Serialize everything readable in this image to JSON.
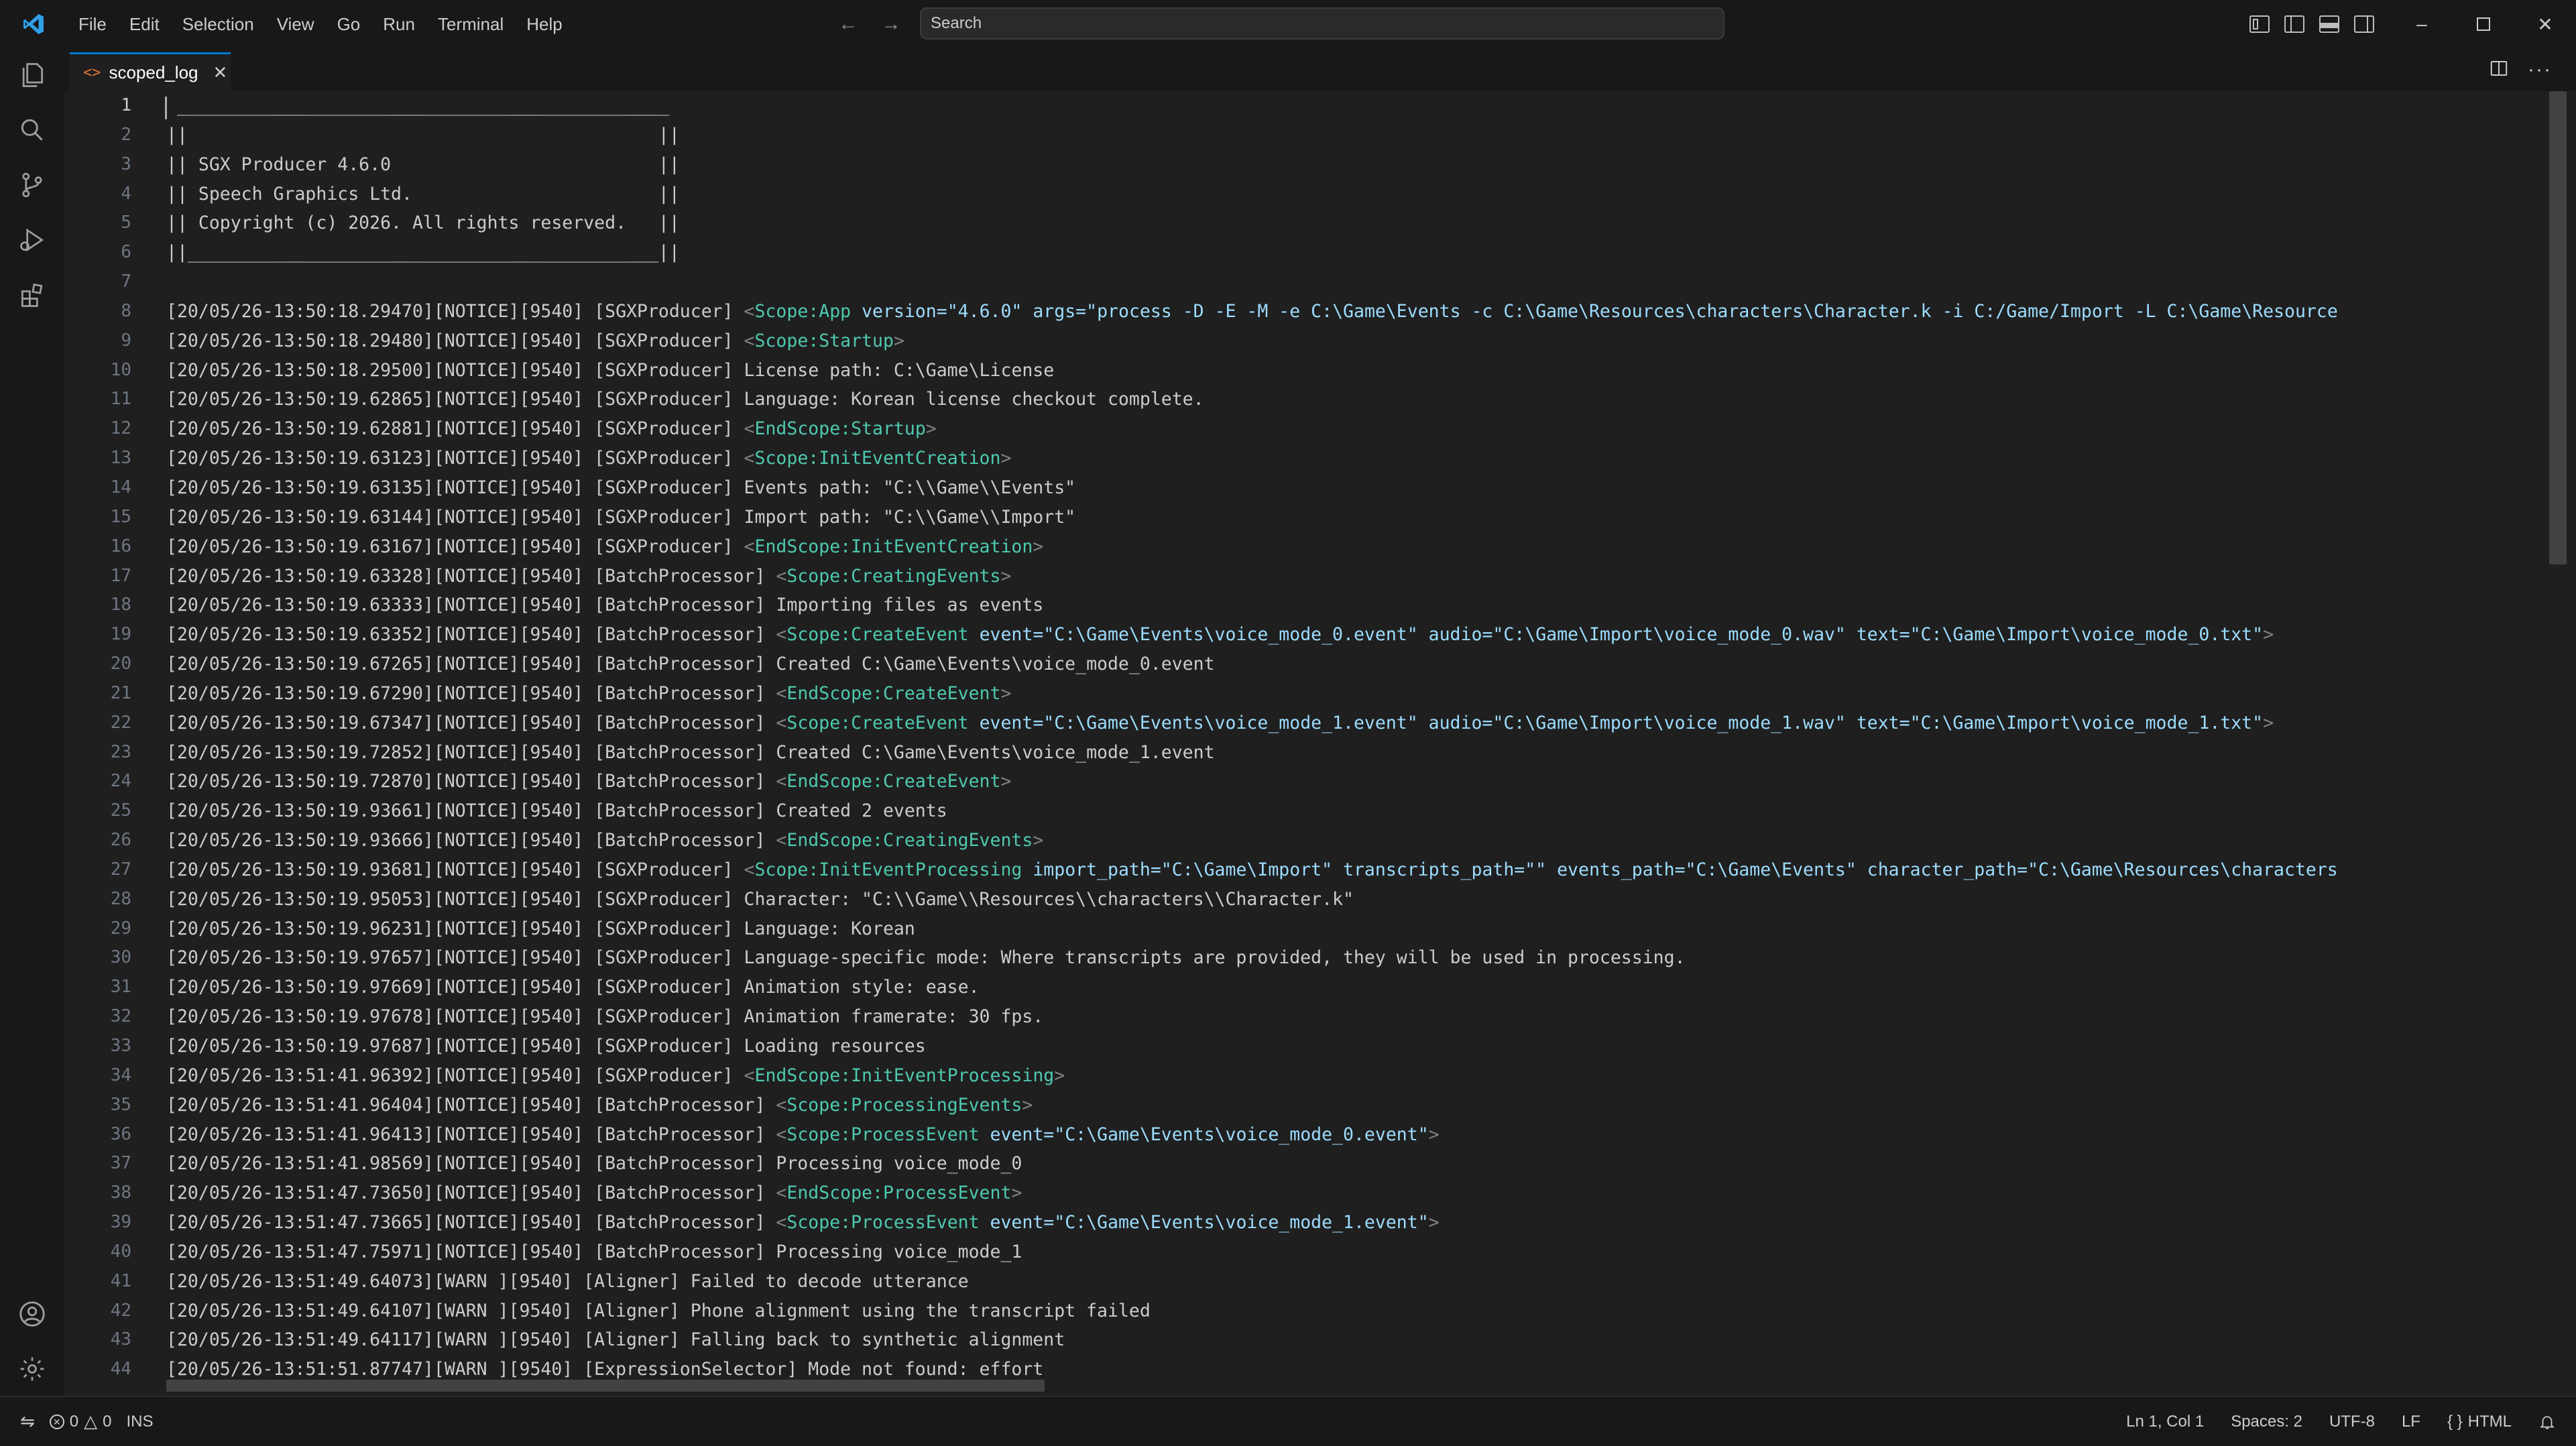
{
  "titlebar": {
    "menus": [
      "File",
      "Edit",
      "Selection",
      "View",
      "Go",
      "Run",
      "Terminal",
      "Help"
    ],
    "search_placeholder": "Search"
  },
  "tab": {
    "label": "scoped_log"
  },
  "editor": {
    "lines": [
      {
        "n": "1",
        "segs": [
          {
            "t": " ______________________________________________"
          }
        ]
      },
      {
        "n": "2",
        "segs": [
          {
            "t": "||                                            ||"
          }
        ]
      },
      {
        "n": "3",
        "segs": [
          {
            "t": "|| SGX Producer 4.6.0                         ||"
          }
        ]
      },
      {
        "n": "4",
        "segs": [
          {
            "t": "|| Speech Graphics Ltd.                       ||"
          }
        ]
      },
      {
        "n": "5",
        "segs": [
          {
            "t": "|| Copyright (c) 2026. All rights reserved.   ||"
          }
        ]
      },
      {
        "n": "6",
        "segs": [
          {
            "t": "||____________________________________________||"
          }
        ]
      },
      {
        "n": "7",
        "segs": [
          {
            "t": ""
          }
        ]
      },
      {
        "n": "8",
        "segs": [
          {
            "t": "[20/05/26-13:50:18.29470][NOTICE][9540] [SGXProducer] "
          },
          {
            "t": "<",
            "c": "tg"
          },
          {
            "t": "Scope:App",
            "c": "nm"
          },
          {
            "t": " version=",
            "c": "at"
          },
          {
            "t": "\"4.6.0\"",
            "c": "at"
          },
          {
            "t": " args=",
            "c": "at"
          },
          {
            "t": "\"process -D -E -M -e C:\\Game\\Events -c C:\\Game\\Resources\\characters\\Character.k -i C:/Game/Import -L C:\\Game\\Resource",
            "c": "at"
          }
        ]
      },
      {
        "n": "9",
        "segs": [
          {
            "t": "[20/05/26-13:50:18.29480][NOTICE][9540] [SGXProducer] "
          },
          {
            "t": "<",
            "c": "tg"
          },
          {
            "t": "Scope:Startup",
            "c": "nm"
          },
          {
            "t": ">",
            "c": "tg"
          }
        ]
      },
      {
        "n": "10",
        "segs": [
          {
            "t": "[20/05/26-13:50:18.29500][NOTICE][9540] [SGXProducer] License path: C:\\Game\\License"
          }
        ]
      },
      {
        "n": "11",
        "segs": [
          {
            "t": "[20/05/26-13:50:19.62865][NOTICE][9540] [SGXProducer] Language: Korean license checkout complete."
          }
        ]
      },
      {
        "n": "12",
        "segs": [
          {
            "t": "[20/05/26-13:50:19.62881][NOTICE][9540] [SGXProducer] "
          },
          {
            "t": "<",
            "c": "tg"
          },
          {
            "t": "EndScope:Startup",
            "c": "en"
          },
          {
            "t": ">",
            "c": "tg"
          }
        ]
      },
      {
        "n": "13",
        "segs": [
          {
            "t": "[20/05/26-13:50:19.63123][NOTICE][9540] [SGXProducer] "
          },
          {
            "t": "<",
            "c": "tg"
          },
          {
            "t": "Scope:InitEventCreation",
            "c": "nm"
          },
          {
            "t": ">",
            "c": "tg"
          }
        ]
      },
      {
        "n": "14",
        "segs": [
          {
            "t": "[20/05/26-13:50:19.63135][NOTICE][9540] [SGXProducer] Events path: \"C:\\\\Game\\\\Events\""
          }
        ]
      },
      {
        "n": "15",
        "segs": [
          {
            "t": "[20/05/26-13:50:19.63144][NOTICE][9540] [SGXProducer] Import path: \"C:\\\\Game\\\\Import\""
          }
        ]
      },
      {
        "n": "16",
        "segs": [
          {
            "t": "[20/05/26-13:50:19.63167][NOTICE][9540] [SGXProducer] "
          },
          {
            "t": "<",
            "c": "tg"
          },
          {
            "t": "EndScope:InitEventCreation",
            "c": "en"
          },
          {
            "t": ">",
            "c": "tg"
          }
        ]
      },
      {
        "n": "17",
        "segs": [
          {
            "t": "[20/05/26-13:50:19.63328][NOTICE][9540] [BatchProcessor] "
          },
          {
            "t": "<",
            "c": "tg"
          },
          {
            "t": "Scope:CreatingEvents",
            "c": "nm"
          },
          {
            "t": ">",
            "c": "tg"
          }
        ]
      },
      {
        "n": "18",
        "segs": [
          {
            "t": "[20/05/26-13:50:19.63333][NOTICE][9540] [BatchProcessor] Importing files as events"
          }
        ]
      },
      {
        "n": "19",
        "segs": [
          {
            "t": "[20/05/26-13:50:19.63352][NOTICE][9540] [BatchProcessor] "
          },
          {
            "t": "<",
            "c": "tg"
          },
          {
            "t": "Scope:CreateEvent",
            "c": "nm"
          },
          {
            "t": " event=\"C:\\Game\\Events\\voice_mode_0.event\" audio=\"C:\\Game\\Import\\voice_mode_0.wav\" text=\"C:\\Game\\Import\\voice_mode_0.txt\"",
            "c": "at"
          },
          {
            "t": ">",
            "c": "tg"
          }
        ]
      },
      {
        "n": "20",
        "segs": [
          {
            "t": "[20/05/26-13:50:19.67265][NOTICE][9540] [BatchProcessor] Created C:\\Game\\Events\\voice_mode_0.event"
          }
        ]
      },
      {
        "n": "21",
        "segs": [
          {
            "t": "[20/05/26-13:50:19.67290][NOTICE][9540] [BatchProcessor] "
          },
          {
            "t": "<",
            "c": "tg"
          },
          {
            "t": "EndScope:CreateEvent",
            "c": "en"
          },
          {
            "t": ">",
            "c": "tg"
          }
        ]
      },
      {
        "n": "22",
        "segs": [
          {
            "t": "[20/05/26-13:50:19.67347][NOTICE][9540] [BatchProcessor] "
          },
          {
            "t": "<",
            "c": "tg"
          },
          {
            "t": "Scope:CreateEvent",
            "c": "nm"
          },
          {
            "t": " event=\"C:\\Game\\Events\\voice_mode_1.event\" audio=\"C:\\Game\\Import\\voice_mode_1.wav\" text=\"C:\\Game\\Import\\voice_mode_1.txt\"",
            "c": "at"
          },
          {
            "t": ">",
            "c": "tg"
          }
        ]
      },
      {
        "n": "23",
        "segs": [
          {
            "t": "[20/05/26-13:50:19.72852][NOTICE][9540] [BatchProcessor] Created C:\\Game\\Events\\voice_mode_1.event"
          }
        ]
      },
      {
        "n": "24",
        "segs": [
          {
            "t": "[20/05/26-13:50:19.72870][NOTICE][9540] [BatchProcessor] "
          },
          {
            "t": "<",
            "c": "tg"
          },
          {
            "t": "EndScope:CreateEvent",
            "c": "en"
          },
          {
            "t": ">",
            "c": "tg"
          }
        ]
      },
      {
        "n": "25",
        "segs": [
          {
            "t": "[20/05/26-13:50:19.93661][NOTICE][9540] [BatchProcessor] Created 2 events"
          }
        ]
      },
      {
        "n": "26",
        "segs": [
          {
            "t": "[20/05/26-13:50:19.93666][NOTICE][9540] [BatchProcessor] "
          },
          {
            "t": "<",
            "c": "tg"
          },
          {
            "t": "EndScope:CreatingEvents",
            "c": "en"
          },
          {
            "t": ">",
            "c": "tg"
          }
        ]
      },
      {
        "n": "27",
        "segs": [
          {
            "t": "[20/05/26-13:50:19.93681][NOTICE][9540] [SGXProducer] "
          },
          {
            "t": "<",
            "c": "tg"
          },
          {
            "t": "Scope:InitEventProcessing",
            "c": "nm"
          },
          {
            "t": " import_path=\"C:\\Game\\Import\" transcripts_path=\"\" events_path=\"C:\\Game\\Events\" character_path=\"C:\\Game\\Resources\\characters",
            "c": "at"
          }
        ]
      },
      {
        "n": "28",
        "segs": [
          {
            "t": "[20/05/26-13:50:19.95053][NOTICE][9540] [SGXProducer] Character: \"C:\\\\Game\\\\Resources\\\\characters\\\\Character.k\""
          }
        ]
      },
      {
        "n": "29",
        "segs": [
          {
            "t": "[20/05/26-13:50:19.96231][NOTICE][9540] [SGXProducer] Language: Korean"
          }
        ]
      },
      {
        "n": "30",
        "segs": [
          {
            "t": "[20/05/26-13:50:19.97657][NOTICE][9540] [SGXProducer] Language-specific mode: Where transcripts are provided, they will be used in processing."
          }
        ]
      },
      {
        "n": "31",
        "segs": [
          {
            "t": "[20/05/26-13:50:19.97669][NOTICE][9540] [SGXProducer] Animation style: ease."
          }
        ]
      },
      {
        "n": "32",
        "segs": [
          {
            "t": "[20/05/26-13:50:19.97678][NOTICE][9540] [SGXProducer] Animation framerate: 30 fps."
          }
        ]
      },
      {
        "n": "33",
        "segs": [
          {
            "t": "[20/05/26-13:50:19.97687][NOTICE][9540] [SGXProducer] Loading resources"
          }
        ]
      },
      {
        "n": "34",
        "segs": [
          {
            "t": "[20/05/26-13:51:41.96392][NOTICE][9540] [SGXProducer] "
          },
          {
            "t": "<",
            "c": "tg"
          },
          {
            "t": "EndScope:InitEventProcessing",
            "c": "en"
          },
          {
            "t": ">",
            "c": "tg"
          }
        ]
      },
      {
        "n": "35",
        "segs": [
          {
            "t": "[20/05/26-13:51:41.96404][NOTICE][9540] [BatchProcessor] "
          },
          {
            "t": "<",
            "c": "tg"
          },
          {
            "t": "Scope:ProcessingEvents",
            "c": "nm"
          },
          {
            "t": ">",
            "c": "tg"
          }
        ]
      },
      {
        "n": "36",
        "segs": [
          {
            "t": "[20/05/26-13:51:41.96413][NOTICE][9540] [BatchProcessor] "
          },
          {
            "t": "<",
            "c": "tg"
          },
          {
            "t": "Scope:ProcessEvent",
            "c": "nm"
          },
          {
            "t": " event=\"C:\\Game\\Events\\voice_mode_0.event\"",
            "c": "at"
          },
          {
            "t": ">",
            "c": "tg"
          }
        ]
      },
      {
        "n": "37",
        "segs": [
          {
            "t": "[20/05/26-13:51:41.98569][NOTICE][9540] [BatchProcessor] Processing voice_mode_0"
          }
        ]
      },
      {
        "n": "38",
        "segs": [
          {
            "t": "[20/05/26-13:51:47.73650][NOTICE][9540] [BatchProcessor] "
          },
          {
            "t": "<",
            "c": "tg"
          },
          {
            "t": "EndScope:ProcessEvent",
            "c": "en"
          },
          {
            "t": ">",
            "c": "tg"
          }
        ]
      },
      {
        "n": "39",
        "segs": [
          {
            "t": "[20/05/26-13:51:47.73665][NOTICE][9540] [BatchProcessor] "
          },
          {
            "t": "<",
            "c": "tg"
          },
          {
            "t": "Scope:ProcessEvent",
            "c": "nm"
          },
          {
            "t": " event=\"C:\\Game\\Events\\voice_mode_1.event\"",
            "c": "at"
          },
          {
            "t": ">",
            "c": "tg"
          }
        ]
      },
      {
        "n": "40",
        "segs": [
          {
            "t": "[20/05/26-13:51:47.75971][NOTICE][9540] [BatchProcessor] Processing voice_mode_1"
          }
        ]
      },
      {
        "n": "41",
        "segs": [
          {
            "t": "[20/05/26-13:51:49.64073][WARN ][9540] [Aligner] Failed to decode utterance"
          }
        ]
      },
      {
        "n": "42",
        "segs": [
          {
            "t": "[20/05/26-13:51:49.64107][WARN ][9540] [Aligner] Phone alignment using the transcript failed"
          }
        ]
      },
      {
        "n": "43",
        "segs": [
          {
            "t": "[20/05/26-13:51:49.64117][WARN ][9540] [Aligner] Falling back to synthetic alignment"
          }
        ]
      },
      {
        "n": "44",
        "segs": [
          {
            "t": "[20/05/26-13:51:51.87747][WARN ][9540] [ExpressionSelector] Mode not found: effort"
          }
        ]
      }
    ]
  },
  "statusbar": {
    "errors": "0",
    "warnings": "0",
    "mode": "INS",
    "position": "Ln 1, Col 1",
    "spaces": "Spaces: 2",
    "encoding": "UTF-8",
    "eol": "LF",
    "language": "HTML"
  },
  "colors": {
    "accent": "#0078d4",
    "scope_name": "#4ec9b0",
    "attribute": "#9cdcfe",
    "tag_bracket": "#808080",
    "tab_icon": "#e37933"
  },
  "icons": {
    "activity": [
      "explorer-icon",
      "search-icon",
      "source-control-icon",
      "run-debug-icon",
      "extensions-icon",
      "account-icon",
      "settings-gear-icon"
    ]
  }
}
